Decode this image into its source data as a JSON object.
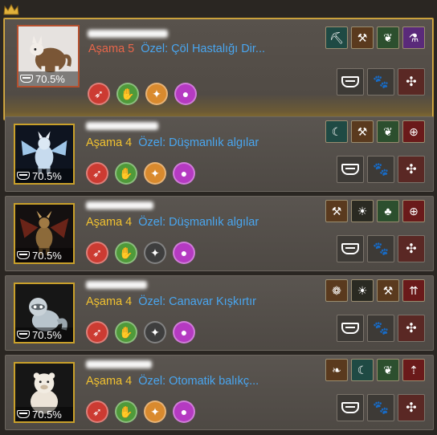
{
  "colors": {
    "stage_featured": "#e8664a",
    "stage": "#f2c230",
    "special": "#49a6f0",
    "frame_gold": "#c9a02a"
  },
  "pets": [
    {
      "affinity": "70.5%",
      "stage_label": "Aşama",
      "stage_num": "5",
      "special_label": "Özel:",
      "special_value": "Çöl Hastalığı Dir...",
      "stats": [
        "red",
        "green",
        "orange",
        "purple"
      ],
      "skills": [
        {
          "icon": "pickaxe-icon",
          "color": "teal"
        },
        {
          "icon": "axe-icon",
          "color": "brown"
        },
        {
          "icon": "wing-icon",
          "color": "green"
        },
        {
          "icon": "potion-icon",
          "color": "purple"
        }
      ],
      "portrait": "wolf"
    },
    {
      "affinity": "70.5%",
      "stage_label": "Aşama",
      "stage_num": "4",
      "special_label": "Özel:",
      "special_value": "Düşmanlık algılar",
      "stats": [
        "red",
        "green",
        "orange",
        "purple"
      ],
      "skills": [
        {
          "icon": "sickle-icon",
          "color": "teal"
        },
        {
          "icon": "axe-icon",
          "color": "brown"
        },
        {
          "icon": "wing-icon",
          "color": "green"
        },
        {
          "icon": "target-icon",
          "color": "red"
        }
      ],
      "portrait": "dragon"
    },
    {
      "affinity": "70.5%",
      "stage_label": "Aşama",
      "stage_num": "4",
      "special_label": "Özel:",
      "special_value": "Düşmanlık algılar",
      "stats": [
        "red",
        "green",
        "gray",
        "purple"
      ],
      "skills": [
        {
          "icon": "hammer-icon",
          "color": "brown"
        },
        {
          "icon": "bug-icon",
          "color": "dark"
        },
        {
          "icon": "clover-icon",
          "color": "green"
        },
        {
          "icon": "target-icon",
          "color": "red"
        }
      ],
      "portrait": "demon"
    },
    {
      "affinity": "70.5%",
      "stage_label": "Aşama",
      "stage_num": "4",
      "special_label": "Özel:",
      "special_value": "Canavar Kışkırtır",
      "stats": [
        "red",
        "green",
        "gray",
        "purple"
      ],
      "skills": [
        {
          "icon": "snail-icon",
          "color": "brown"
        },
        {
          "icon": "bug-icon",
          "color": "dark"
        },
        {
          "icon": "axe-icon",
          "color": "brown"
        },
        {
          "icon": "arrows-up-icon",
          "color": "red"
        }
      ],
      "portrait": "raccoon"
    },
    {
      "affinity": "70.5%",
      "stage_label": "Aşama",
      "stage_num": "4",
      "special_label": "Özel:",
      "special_value": "Otomatik balıkç...",
      "stats": [
        "red",
        "green",
        "orange",
        "purple"
      ],
      "skills": [
        {
          "icon": "leaf-icon",
          "color": "brown"
        },
        {
          "icon": "sickle-icon",
          "color": "teal"
        },
        {
          "icon": "wing-icon",
          "color": "green"
        },
        {
          "icon": "person-up-icon",
          "color": "red"
        }
      ],
      "portrait": "bear"
    }
  ]
}
